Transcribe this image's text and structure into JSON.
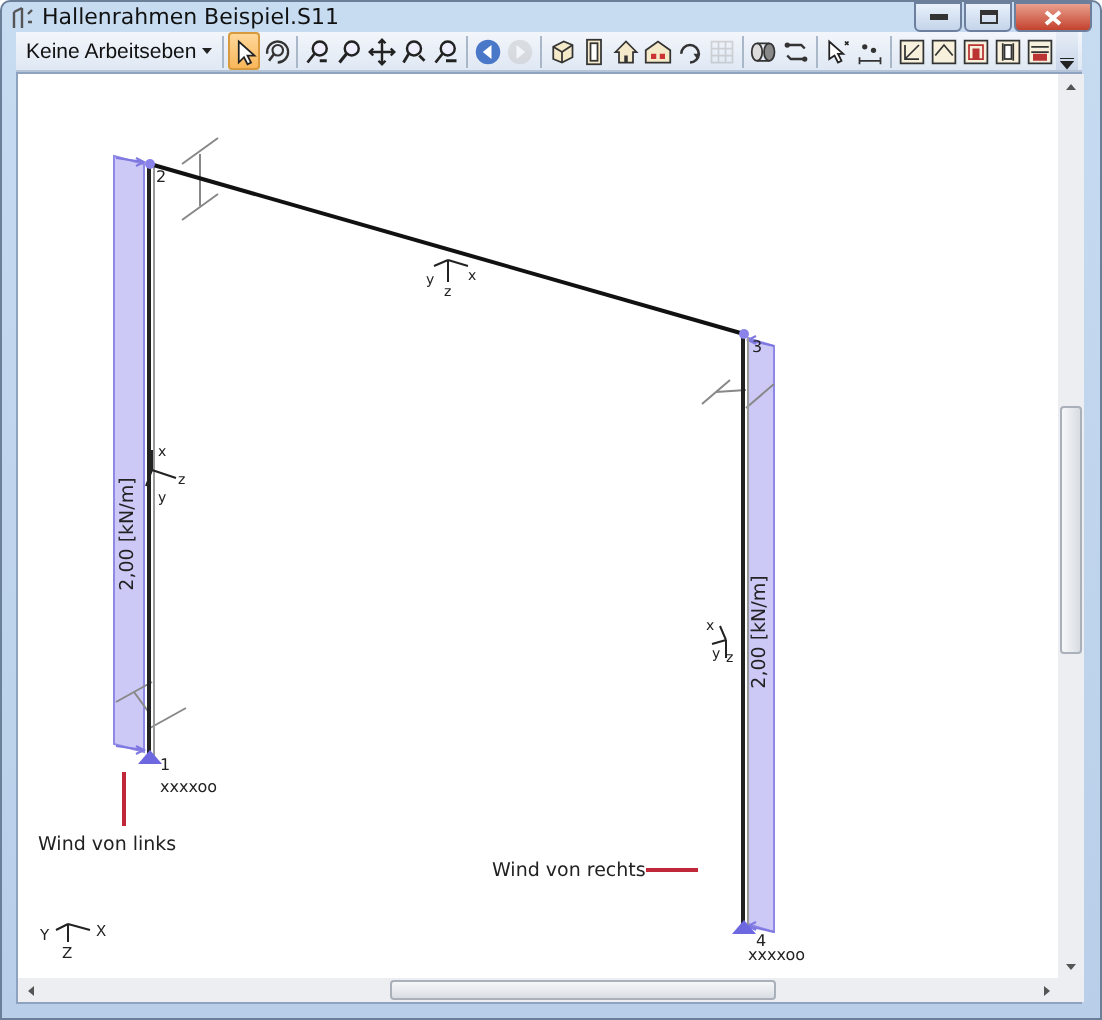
{
  "window": {
    "title": "Hallenrahmen Beispiel.S11"
  },
  "toolbar": [
    {
      "kind": "dropdown",
      "label": "Keine Arbeitseben"
    },
    {
      "kind": "separator"
    },
    {
      "kind": "tool",
      "selected": true,
      "disabled": false
    },
    {
      "kind": "tool",
      "selected": false,
      "disabled": false
    },
    {
      "kind": "separator"
    },
    {
      "kind": "tool",
      "selected": false,
      "disabled": false
    },
    {
      "kind": "tool",
      "selected": false,
      "disabled": false
    },
    {
      "kind": "tool",
      "selected": false,
      "disabled": false
    },
    {
      "kind": "tool",
      "selected": false,
      "disabled": false
    },
    {
      "kind": "tool",
      "selected": false,
      "disabled": false
    },
    {
      "kind": "separator"
    },
    {
      "kind": "tool",
      "selected": false,
      "disabled": false
    },
    {
      "kind": "tool",
      "selected": false,
      "disabled": true
    },
    {
      "kind": "separator"
    },
    {
      "kind": "tool",
      "selected": false,
      "disabled": false
    },
    {
      "kind": "tool",
      "selected": false,
      "disabled": false
    },
    {
      "kind": "tool",
      "selected": false,
      "disabled": false
    },
    {
      "kind": "tool",
      "selected": false,
      "disabled": false
    },
    {
      "kind": "tool",
      "selected": false,
      "disabled": false
    },
    {
      "kind": "tool",
      "selected": false,
      "disabled": true
    },
    {
      "kind": "separator"
    },
    {
      "kind": "tool",
      "selected": false,
      "disabled": false
    },
    {
      "kind": "tool",
      "selected": false,
      "disabled": false
    },
    {
      "kind": "separator"
    },
    {
      "kind": "tool",
      "selected": false,
      "disabled": false
    },
    {
      "kind": "tool",
      "selected": false,
      "disabled": false
    },
    {
      "kind": "separator"
    },
    {
      "kind": "tool",
      "selected": false,
      "disabled": false
    },
    {
      "kind": "tool",
      "selected": false,
      "disabled": false
    },
    {
      "kind": "tool",
      "selected": false,
      "disabled": false
    },
    {
      "kind": "tool",
      "selected": false,
      "disabled": false
    },
    {
      "kind": "tool",
      "selected": false,
      "disabled": false
    },
    {
      "kind": "overflow"
    }
  ],
  "model": {
    "nodes": [
      {
        "label": "2"
      },
      {
        "label": "3"
      },
      {
        "label": "1"
      },
      {
        "label": "4"
      }
    ],
    "loads": [
      {
        "label": "2,00 [kN/m]"
      },
      {
        "label": "2,00 [kN/m]"
      }
    ],
    "member_axes": [
      {
        "labels": [
          "x",
          "y",
          "z"
        ]
      },
      {
        "labels": [
          "x",
          "y",
          "z"
        ]
      },
      {
        "labels": [
          "x",
          "y",
          "z"
        ]
      }
    ],
    "supports": [
      {
        "label": "xxxxoo"
      },
      {
        "label": "xxxxoo"
      }
    ],
    "wind_notes": [
      {
        "label": "Wind von links"
      },
      {
        "label": "Wind von rechts"
      }
    ],
    "global_axes": {
      "labels": [
        "Y",
        "X",
        "Z"
      ]
    }
  }
}
